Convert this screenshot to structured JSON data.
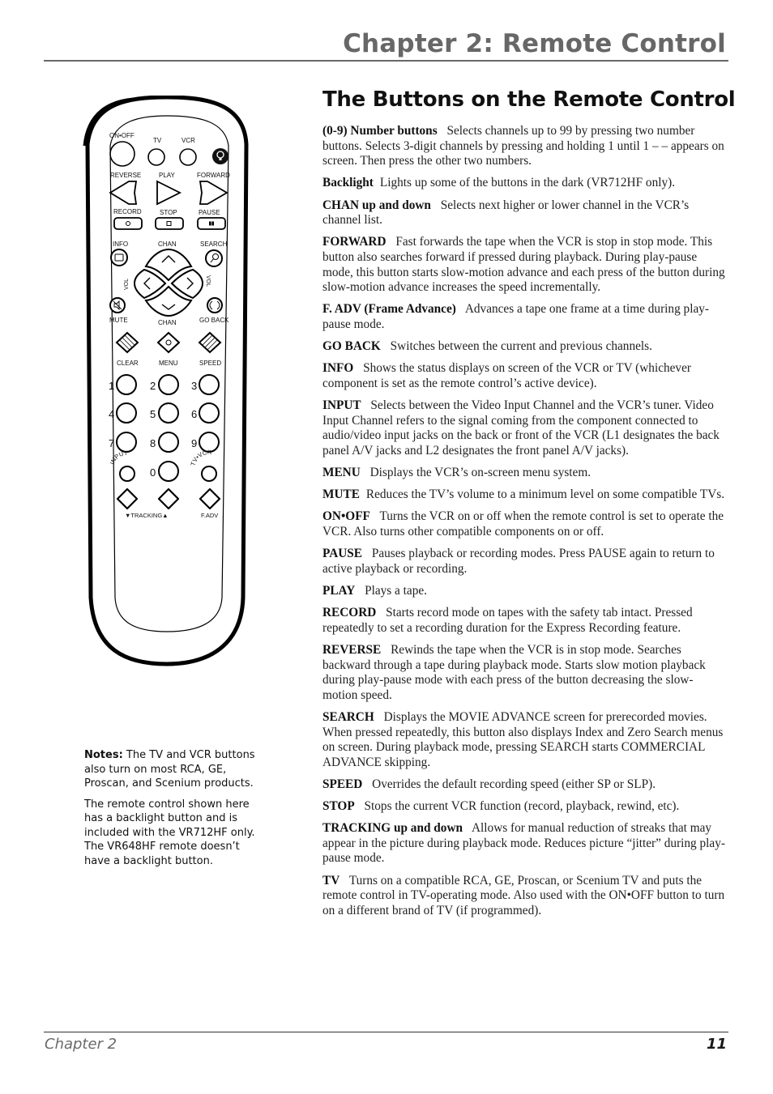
{
  "header": {
    "chapter_title": "Chapter 2: Remote Control"
  },
  "section": {
    "title": "The Buttons on the Remote Control"
  },
  "definitions": [
    {
      "term": "(0-9) Number buttons",
      "text": "Selects channels up to 99 by pressing two number buttons. Selects 3-digit channels by pressing and holding 1 until 1 – – appears on screen. Then press the other two numbers."
    },
    {
      "term": "Backlight",
      "text": "Lights up some of the buttons in the dark (VR712HF only)."
    },
    {
      "term": "CHAN up and down",
      "text": "Selects next higher or lower channel in the VCR’s channel list."
    },
    {
      "term": "FORWARD",
      "text": "Fast forwards the tape when the VCR is stop in stop mode. This button also searches forward if pressed during playback. During play-pause mode,  this button starts slow-motion advance and each press of the button during slow-motion advance increases the speed incrementally."
    },
    {
      "term": "F. ADV (Frame Advance)",
      "text": "Advances a tape one frame at a time during play-pause mode."
    },
    {
      "term": "GO BACK",
      "text": "Switches between the current and previous channels."
    },
    {
      "term": "INFO",
      "text": "Shows the status displays on screen of the VCR or TV (whichever component is set as the remote control’s active device)."
    },
    {
      "term": "INPUT",
      "text": "Selects between the Video Input Channel and the VCR’s tuner. Video Input Channel refers to the signal coming from the component connected to audio/video input jacks on the back or front of the VCR (L1 designates the back panel A/V jacks and L2 designates the front panel A/V jacks)."
    },
    {
      "term": "MENU",
      "text": "Displays the VCR’s on-screen menu system."
    },
    {
      "term": "MUTE",
      "text": "Reduces the TV’s volume to a minimum level on some compatible TVs."
    },
    {
      "term": "ON•OFF",
      "text": "Turns the VCR on or off when the remote control is set to operate the VCR. Also turns other compatible components on or off."
    },
    {
      "term": "PAUSE",
      "text": "Pauses playback or recording modes. Press PAUSE again to return to active playback or recording."
    },
    {
      "term": "PLAY",
      "text": "Plays a tape."
    },
    {
      "term": "RECORD",
      "text": "Starts record mode on tapes with the safety tab intact. Pressed repeatedly to set a recording duration for the Express Recording feature."
    },
    {
      "term": "REVERSE",
      "text": "Rewinds the tape when the VCR is in stop mode. Searches backward through a tape during playback mode. Starts slow motion playback during play-pause mode with each press of the button decreasing the slow-motion speed."
    },
    {
      "term": "SEARCH",
      "text": "Displays the MOVIE ADVANCE screen for prerecorded movies. When pressed repeatedly, this button also displays Index and Zero Search menus on screen. During playback mode, pressing SEARCH starts COMMERCIAL ADVANCE skipping."
    },
    {
      "term": "SPEED",
      "text": "Overrides the default recording speed (either SP or SLP)."
    },
    {
      "term": "STOP",
      "text": "Stops the current VCR function (record, playback, rewind, etc)."
    },
    {
      "term": "TRACKING up and down",
      "text": "Allows for manual reduction of streaks that may appear in the picture during playback mode. Reduces picture “jitter” during play-pause mode."
    },
    {
      "term": "TV",
      "text": "Turns on a compatible RCA, GE, Proscan, or Scenium TV and puts the remote control in TV-operating mode. Also used with the ON•OFF button to turn on a different brand of TV (if programmed)."
    }
  ],
  "notes": {
    "label": "Notes:",
    "first": "The TV and VCR buttons also turn on most RCA, GE, Proscan, and Scenium products.",
    "second": "The remote control shown here has a backlight button and is included with the VR712HF only.  The VR648HF remote doesn’t have a backlight button."
  },
  "remote": {
    "labels": {
      "on_off": "ON•OFF",
      "tv": "TV",
      "vcr": "VCR",
      "reverse": "REVERSE",
      "play": "PLAY",
      "forward": "FORWARD",
      "record": "RECORD",
      "stop": "STOP",
      "pause": "PAUSE",
      "info": "INFO",
      "chan_top": "CHAN",
      "search": "SEARCH",
      "vol_left": "VOL",
      "vol_right": "VOL",
      "mute": "MUTE",
      "chan_bottom": "CHAN",
      "go_back": "GO BACK",
      "clear": "CLEAR",
      "menu": "MENU",
      "speed": "SPEED",
      "input": "INPUT",
      "tv_vcr": "TV•VCR",
      "tracking": "▼TRACKING▲",
      "f_adv": "F.ADV"
    },
    "digits": [
      "1",
      "2",
      "3",
      "4",
      "5",
      "6",
      "7",
      "8",
      "9",
      "0"
    ]
  },
  "footer": {
    "chapter": "Chapter 2",
    "page_number": "11"
  }
}
